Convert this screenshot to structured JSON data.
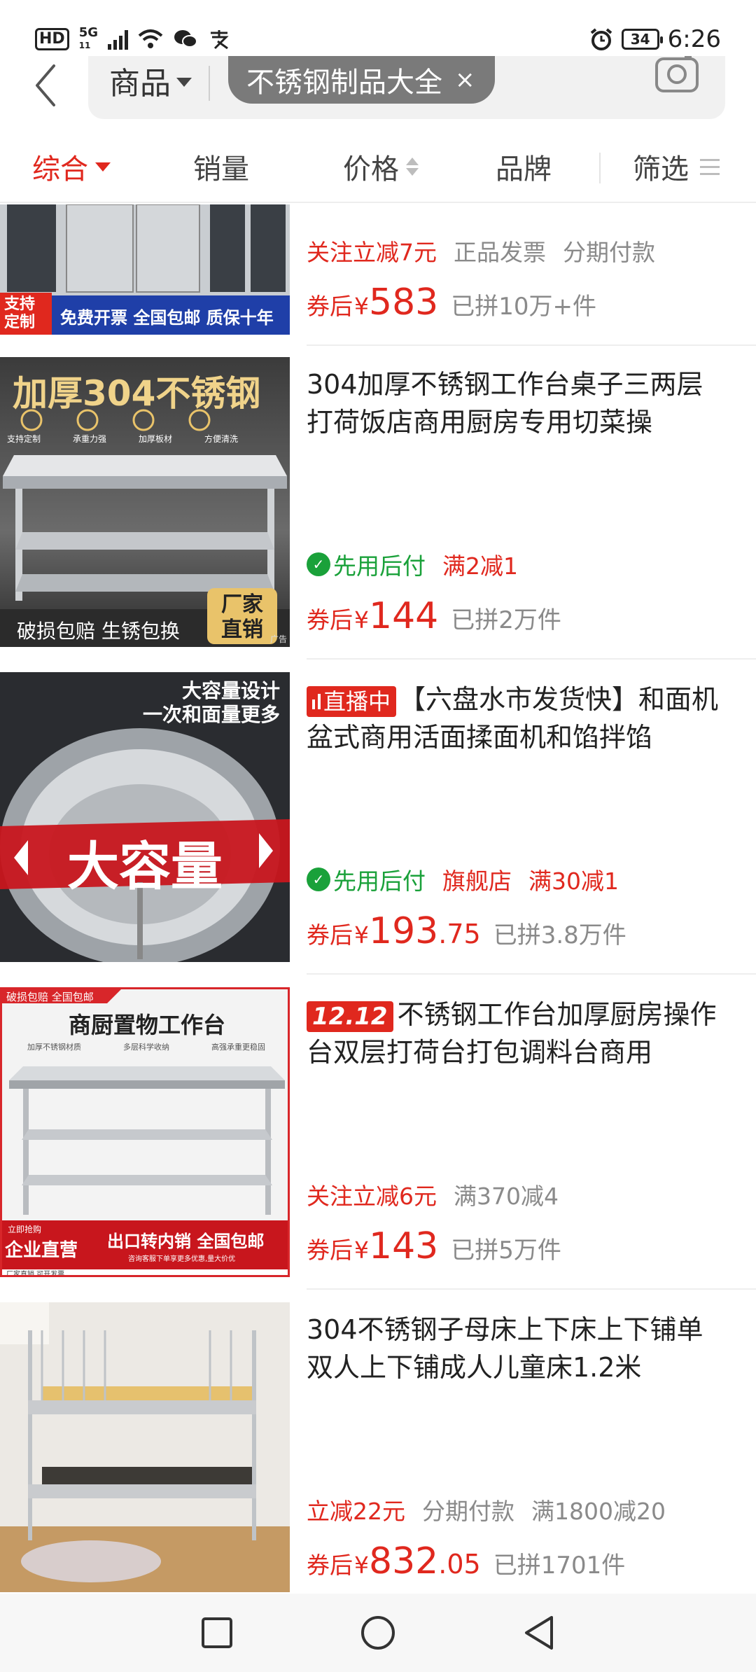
{
  "status_bar": {
    "hd": "HD",
    "network": "5G",
    "network_sub": "11",
    "battery": "34",
    "time": "6:26"
  },
  "search": {
    "scope_label": "商品",
    "query_chip": "不锈钢制品大全",
    "chip_close": "×"
  },
  "filters": [
    {
      "label": "综合",
      "active": true
    },
    {
      "label": "销量"
    },
    {
      "label": "价格"
    },
    {
      "label": "品牌"
    },
    {
      "label": "筛选"
    }
  ],
  "products": [
    {
      "title": "",
      "thumb_caption_left": "支持定制",
      "thumb_caption": "免费开票 全国包邮 质保十年",
      "tags": [
        {
          "text": "关注立减7元",
          "style": "red"
        },
        {
          "text": "正品发票",
          "style": "gray"
        },
        {
          "text": "分期付款",
          "style": "gray"
        }
      ],
      "price_label": "券后",
      "currency": "¥",
      "price_int": "583",
      "price_dec": "",
      "sold": "已拼10万+件"
    },
    {
      "title": "304加厚不锈钢工作台桌子三两层打荷饭店商用厨房专用切菜操",
      "thumb_heading": "加厚304不锈钢",
      "thumb_features": [
        "支持定制",
        "承重力强",
        "加厚板材",
        "方便清洗"
      ],
      "thumb_caption": "破损包赔 生锈包换",
      "thumb_corner": "厂家直销",
      "thumb_ad": "广告",
      "tags": [
        {
          "text": "先用后付",
          "style": "green"
        },
        {
          "text": "满2减1",
          "style": "red"
        }
      ],
      "price_label": "券后",
      "currency": "¥",
      "price_int": "144",
      "price_dec": "",
      "sold": "已拼2万件"
    },
    {
      "live_badge": "直播中",
      "title": "【六盘水市发货快】和面机盆式商用活面揉面机和馅拌馅",
      "thumb_heading_1": "大容量设计",
      "thumb_heading_2": "一次和面量更多",
      "thumb_banner": "大容量",
      "tags": [
        {
          "text": "先用后付",
          "style": "green"
        },
        {
          "text": "旗舰店",
          "style": "red"
        },
        {
          "text": "满30减1",
          "style": "red"
        }
      ],
      "price_label": "券后",
      "currency": "¥",
      "price_int": "193",
      "price_dec": ".75",
      "sold": "已拼3.8万件"
    },
    {
      "promo_badge": "12.12",
      "title": "不锈钢工作台加厚厨房操作台双层打荷台打包调料台商用",
      "thumb_top": "破损包赔 全国包邮",
      "thumb_heading": "商厨置物工作台",
      "thumb_features": [
        "加厚不锈钢材质",
        "多层科学收纳",
        "高强承重更稳固"
      ],
      "thumb_bottom_left_small": "立即抢购",
      "thumb_bottom_left": "企业直营",
      "thumb_bottom_right": "出口转内销 全国包邮",
      "thumb_bottom_note": "咨询客服下单享更多优惠,量大价优",
      "thumb_footer": "厂家直销 可开发票",
      "tags": [
        {
          "text": "关注立减6元",
          "style": "red"
        },
        {
          "text": "满370减4",
          "style": "gray"
        }
      ],
      "price_label": "券后",
      "currency": "¥",
      "price_int": "143",
      "price_dec": "",
      "sold": "已拼5万件"
    },
    {
      "title": "304不锈钢子母床上下床上下铺单双人上下铺成人儿童床1.2米",
      "tags": [
        {
          "text": "立减22元",
          "style": "red"
        },
        {
          "text": "分期付款",
          "style": "gray"
        },
        {
          "text": "满1800减20",
          "style": "gray"
        }
      ],
      "price_label": "券后",
      "currency": "¥",
      "price_int": "832",
      "price_dec": ".05",
      "sold": "已拼1701件"
    }
  ],
  "colors": {
    "accent": "#e0281e",
    "gray_text": "#8a8a8a",
    "green": "#1aa13a"
  },
  "icons": {
    "back": "back-arrow-icon",
    "camera": "camera-icon",
    "nav_recents": "square-icon",
    "nav_home": "circle-icon",
    "nav_back": "triangle-back-icon"
  }
}
